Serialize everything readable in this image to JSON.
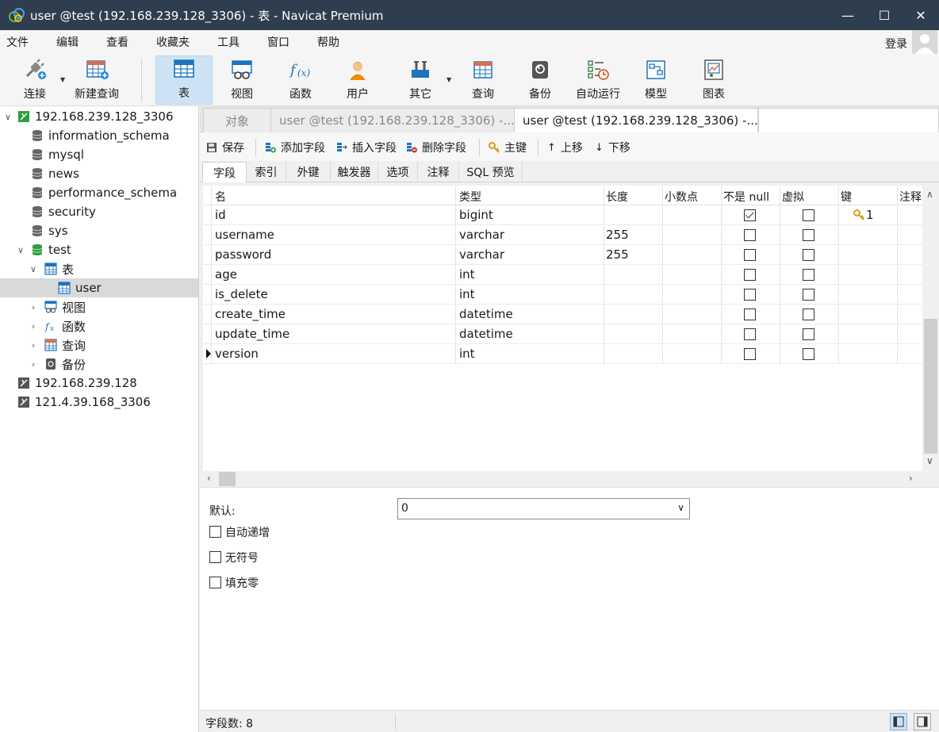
{
  "window": {
    "title": "user @test (192.168.239.128_3306) - 表 - Navicat Premium",
    "minimize": "—",
    "maximize": "☐",
    "close": "✕"
  },
  "menu": {
    "items": [
      "文件",
      "编辑",
      "查看",
      "收藏夹",
      "工具",
      "窗口",
      "帮助"
    ],
    "login": "登录"
  },
  "toolbar": {
    "connect": "连接",
    "new_query": "新建查询",
    "table": "表",
    "view": "视图",
    "function": "函数",
    "user": "用户",
    "other": "其它",
    "query": "查询",
    "backup": "备份",
    "auto_run": "自动运行",
    "model": "模型",
    "chart": "图表"
  },
  "sidebar": {
    "items": [
      {
        "label": "192.168.239.128_3306",
        "icon": "connection-icon"
      },
      {
        "label": "information_schema",
        "icon": "database-icon"
      },
      {
        "label": "mysql",
        "icon": "database-icon"
      },
      {
        "label": "news",
        "icon": "database-icon"
      },
      {
        "label": "performance_schema",
        "icon": "database-icon"
      },
      {
        "label": "security",
        "icon": "database-icon"
      },
      {
        "label": "sys",
        "icon": "database-icon"
      },
      {
        "label": "test",
        "icon": "database-open-icon"
      },
      {
        "label": "表",
        "icon": "table-icon"
      },
      {
        "label": "user",
        "icon": "table-icon"
      },
      {
        "label": "视图",
        "icon": "view-icon"
      },
      {
        "label": "函数",
        "icon": "function-icon"
      },
      {
        "label": "查询",
        "icon": "query-icon"
      },
      {
        "label": "备份",
        "icon": "backup-icon"
      },
      {
        "label": "192.168.239.128",
        "icon": "connection-icon"
      },
      {
        "label": "121.4.39.168_3306",
        "icon": "connection-icon"
      }
    ]
  },
  "tabs": {
    "objects": "对象",
    "tab1": "user @test (192.168.239.128_3306) -...",
    "tab2": "user @test (192.168.239.128_3306) -..."
  },
  "fieldbar": {
    "save": "保存",
    "add_field": "添加字段",
    "insert_field": "插入字段",
    "delete_field": "删除字段",
    "primary_key": "主键",
    "move_up": "上移",
    "move_down": "下移"
  },
  "subtabs": [
    "字段",
    "索引",
    "外键",
    "触发器",
    "选项",
    "注释",
    "SQL 预览"
  ],
  "grid": {
    "headers": [
      "名",
      "类型",
      "长度",
      "小数点",
      "不是 null",
      "虚拟",
      "键",
      "注释"
    ],
    "rows": [
      {
        "name": "id",
        "type": "bigint",
        "length": "",
        "not_null": true,
        "virtual": false,
        "key": "1"
      },
      {
        "name": "username",
        "type": "varchar",
        "length": "255",
        "not_null": false,
        "virtual": false,
        "key": ""
      },
      {
        "name": "password",
        "type": "varchar",
        "length": "255",
        "not_null": false,
        "virtual": false,
        "key": ""
      },
      {
        "name": "age",
        "type": "int",
        "length": "",
        "not_null": false,
        "virtual": false,
        "key": ""
      },
      {
        "name": "is_delete",
        "type": "int",
        "length": "",
        "not_null": false,
        "virtual": false,
        "key": ""
      },
      {
        "name": "create_time",
        "type": "datetime",
        "length": "",
        "not_null": false,
        "virtual": false,
        "key": ""
      },
      {
        "name": "update_time",
        "type": "datetime",
        "length": "",
        "not_null": false,
        "virtual": false,
        "key": ""
      },
      {
        "name": "version",
        "type": "int",
        "length": "",
        "not_null": false,
        "virtual": false,
        "key": ""
      }
    ]
  },
  "props": {
    "default_label": "默认:",
    "default_value": "0",
    "auto_increment": "自动递增",
    "unsigned": "无符号",
    "zerofill": "填充零"
  },
  "status": {
    "field_count": "字段数: 8"
  }
}
